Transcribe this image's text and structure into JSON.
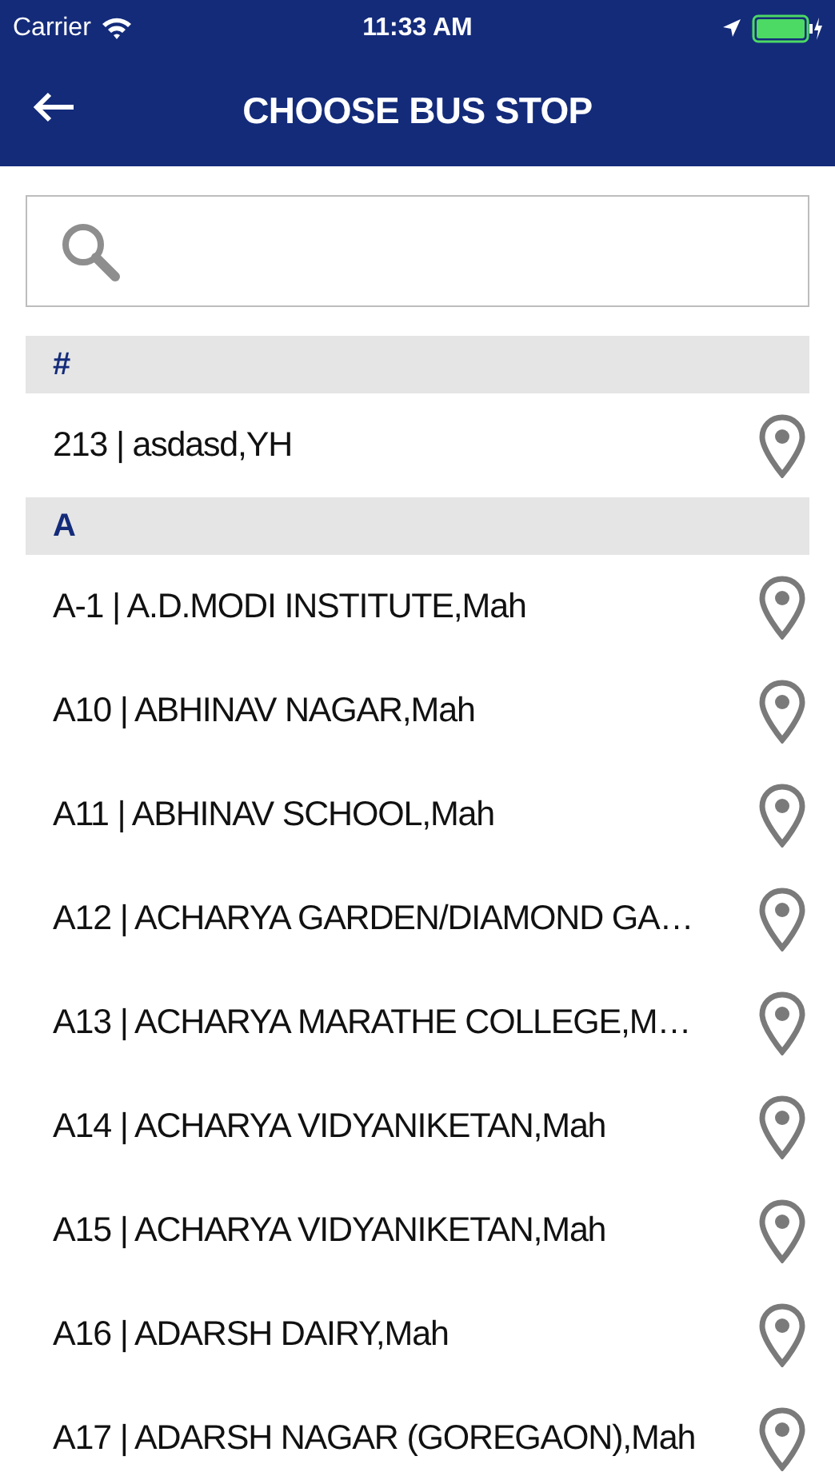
{
  "status_bar": {
    "carrier": "Carrier",
    "time": "11:33 AM"
  },
  "nav_bar": {
    "title": "CHOOSE BUS STOP"
  },
  "sections": [
    {
      "header": "#",
      "stops": [
        "213 | asdasd,YH"
      ]
    },
    {
      "header": "A",
      "stops": [
        "A-1 | A.D.MODI INSTITUTE,Mah",
        "A10 | ABHINAV NAGAR,Mah",
        "A11 | ABHINAV SCHOOL,Mah",
        "A12 | ACHARYA GARDEN/DIAMOND GA…",
        "A13 | ACHARYA MARATHE COLLEGE,M…",
        "A14 | ACHARYA VIDYANIKETAN,Mah",
        "A15 | ACHARYA VIDYANIKETAN,Mah",
        "A16 | ADARSH DAIRY,Mah",
        "A17 | ADARSH NAGAR (GOREGAON),Mah"
      ]
    }
  ]
}
